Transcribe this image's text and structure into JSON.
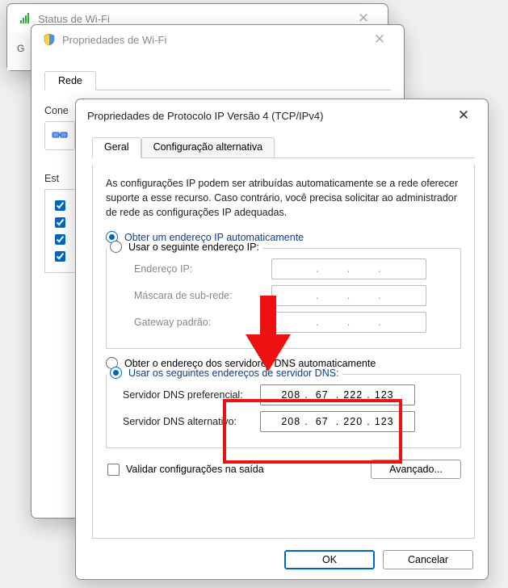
{
  "bg1": {
    "title": "Status de Wi-Fi",
    "body_hint": "G"
  },
  "bg2": {
    "title": "Propriedades de Wi-Fi",
    "tab": "Rede",
    "section1": "Cone",
    "section2": "Est",
    "check_items": [
      "",
      "",
      "",
      ""
    ]
  },
  "dlg": {
    "title": "Propriedades de Protocolo IP Versão 4 (TCP/IPv4)",
    "tabs": {
      "general": "Geral",
      "alt": "Configuração alternativa"
    },
    "desc": "As configurações IP podem ser atribuídas automaticamente se a rede oferecer suporte a esse recurso. Caso contrário, você precisa solicitar ao administrador de rede as configurações IP adequadas.",
    "ip_auto": "Obter um endereço IP automaticamente",
    "ip_manual": "Usar o seguinte endereço IP:",
    "ip_addr_lbl": "Endereço IP:",
    "ip_mask_lbl": "Máscara de sub-rede:",
    "ip_gw_lbl": "Gateway padrão:",
    "dns_auto": "Obter o endereço dos servidores DNS automaticamente",
    "dns_manual": "Usar os seguintes endereços de servidor DNS:",
    "dns_pref_lbl": "Servidor DNS preferencial:",
    "dns_alt_lbl": "Servidor DNS alternativo:",
    "dns_pref": {
      "a": "208",
      "b": "67",
      "c": "222",
      "d": "123"
    },
    "dns_alt": {
      "a": "208",
      "b": "67",
      "c": "220",
      "d": "123"
    },
    "validate": "Validar configurações na saída",
    "advanced": "Avançado...",
    "ok": "OK",
    "cancel": "Cancelar"
  }
}
